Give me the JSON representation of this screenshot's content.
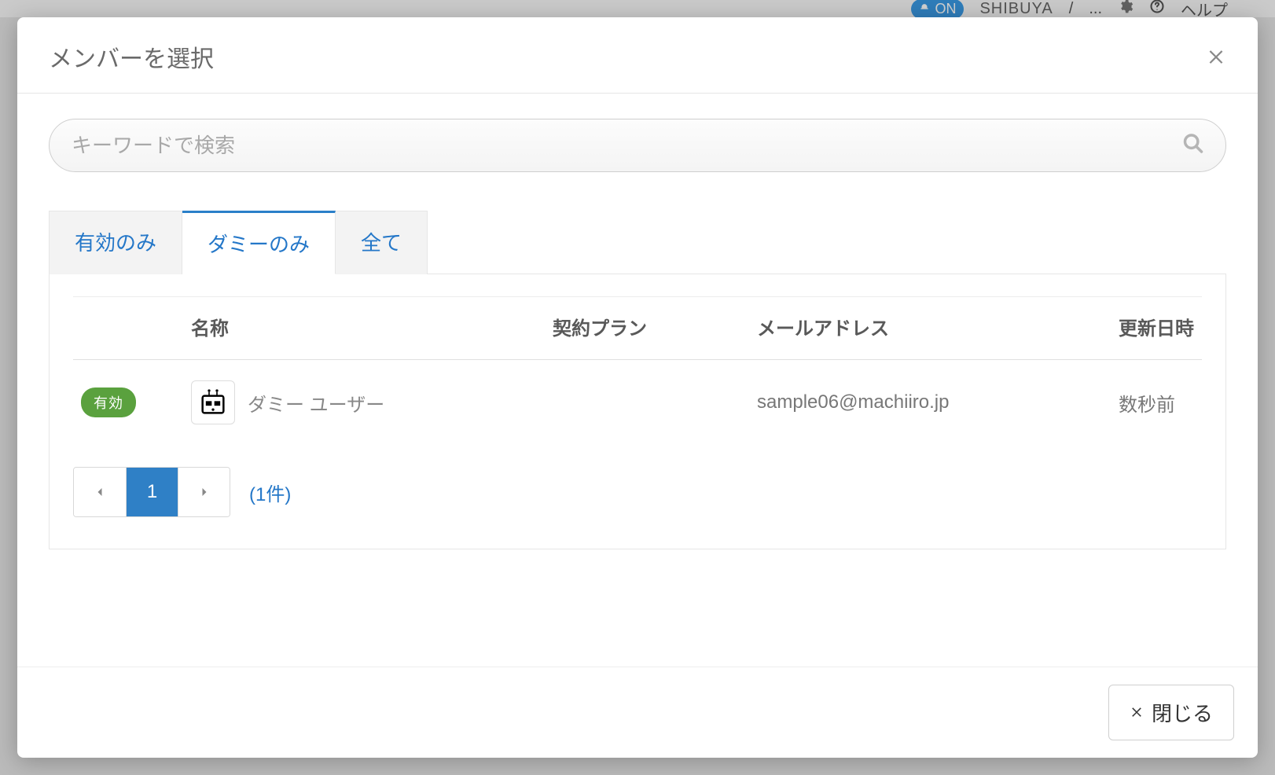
{
  "background": {
    "on_badge": "ON",
    "user_label": "SHIBUYA",
    "separator": "/",
    "more": "...",
    "help_label": "ヘルプ"
  },
  "modal": {
    "title": "メンバーを選択",
    "search": {
      "placeholder": "キーワードで検索"
    },
    "tabs": {
      "valid_only": "有効のみ",
      "dummy_only": "ダミーのみ",
      "all": "全て",
      "active": "dummy_only"
    },
    "table": {
      "headers": {
        "name": "名称",
        "plan": "契約プラン",
        "email": "メールアドレス",
        "updated": "更新日時"
      },
      "rows": [
        {
          "status_badge": "有効",
          "name": "ダミー ユーザー",
          "plan": "",
          "email": "sample06@machiiro.jp",
          "updated": "数秒前"
        }
      ]
    },
    "pagination": {
      "current_page": "1",
      "count_label": "(1件)"
    },
    "footer": {
      "close_label": "閉じる"
    }
  }
}
